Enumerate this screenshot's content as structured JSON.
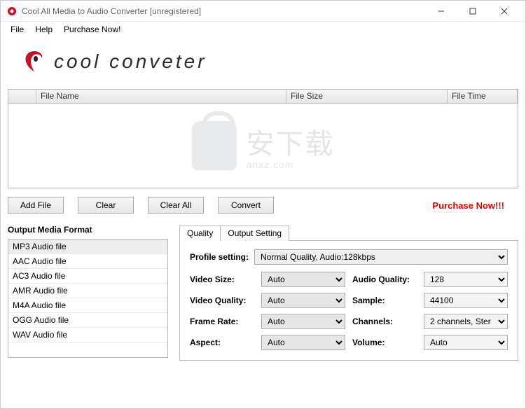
{
  "window": {
    "title": "Cool All Media to Audio Converter  [unregistered]"
  },
  "menu": {
    "file": "File",
    "help": "Help",
    "purchase": "Purchase Now!"
  },
  "logo": {
    "text": "cool conveter"
  },
  "grid": {
    "col_name": "File Name",
    "col_size": "File Size",
    "col_time": "File Time"
  },
  "watermark": {
    "main": "安下载",
    "sub": "anxz.com"
  },
  "buttons": {
    "add": "Add File",
    "clear": "Clear",
    "clearall": "Clear All",
    "convert": "Convert"
  },
  "purchase_link": "Purchase Now!!!",
  "format": {
    "title": "Output Media Format",
    "items": [
      "MP3 Audio file",
      "AAC Audio file",
      "AC3 Audio file",
      "AMR Audio file",
      "M4A Audio file",
      "OGG Audio file",
      "WAV Audio file"
    ]
  },
  "tabs": {
    "quality": "Quality",
    "output": "Output Setting"
  },
  "profile": {
    "label": "Profile setting:",
    "value": "Normal Quality, Audio:128kbps"
  },
  "settings": {
    "video_size_lbl": "Video Size:",
    "video_size": "Auto",
    "video_quality_lbl": "Video Quality:",
    "video_quality": "Auto",
    "frame_rate_lbl": "Frame Rate:",
    "frame_rate": "Auto",
    "aspect_lbl": "Aspect:",
    "aspect": "Auto",
    "audio_quality_lbl": "Audio Quality:",
    "audio_quality": "128",
    "sample_lbl": "Sample:",
    "sample": "44100",
    "channels_lbl": "Channels:",
    "channels": "2 channels, Ster",
    "volume_lbl": "Volume:",
    "volume": "Auto"
  }
}
